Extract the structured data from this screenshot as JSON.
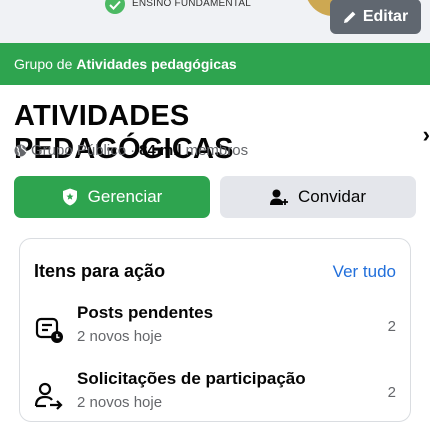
{
  "cover": {
    "badge_text": "ENSINO FUNDAMENTAL",
    "edit_label": "Editar"
  },
  "group_bar": {
    "prefix": "Grupo de",
    "name": "Atividades pedagógicas"
  },
  "header": {
    "title": "ATIVIDADES PEDAGÓGICAS",
    "chevron": "›"
  },
  "meta": {
    "privacy": "Grupo Público",
    "separator": "·",
    "member_count": "84 mil",
    "members_label": "membros"
  },
  "actions": {
    "manage_label": "Gerenciar",
    "invite_label": "Convidar"
  },
  "action_items": {
    "title": "Itens para ação",
    "see_all": "Ver tudo",
    "items": [
      {
        "icon": "pending-posts-icon",
        "title": "Posts pendentes",
        "subtitle": "2 novos hoje",
        "count": "2"
      },
      {
        "icon": "join-requests-icon",
        "title": "Solicitações de participação",
        "subtitle": "2 novos hoje",
        "count": "2"
      }
    ]
  },
  "colors": {
    "brand_green": "#2ea44f",
    "link_blue": "#216fdb",
    "muted_text": "#65676b"
  }
}
